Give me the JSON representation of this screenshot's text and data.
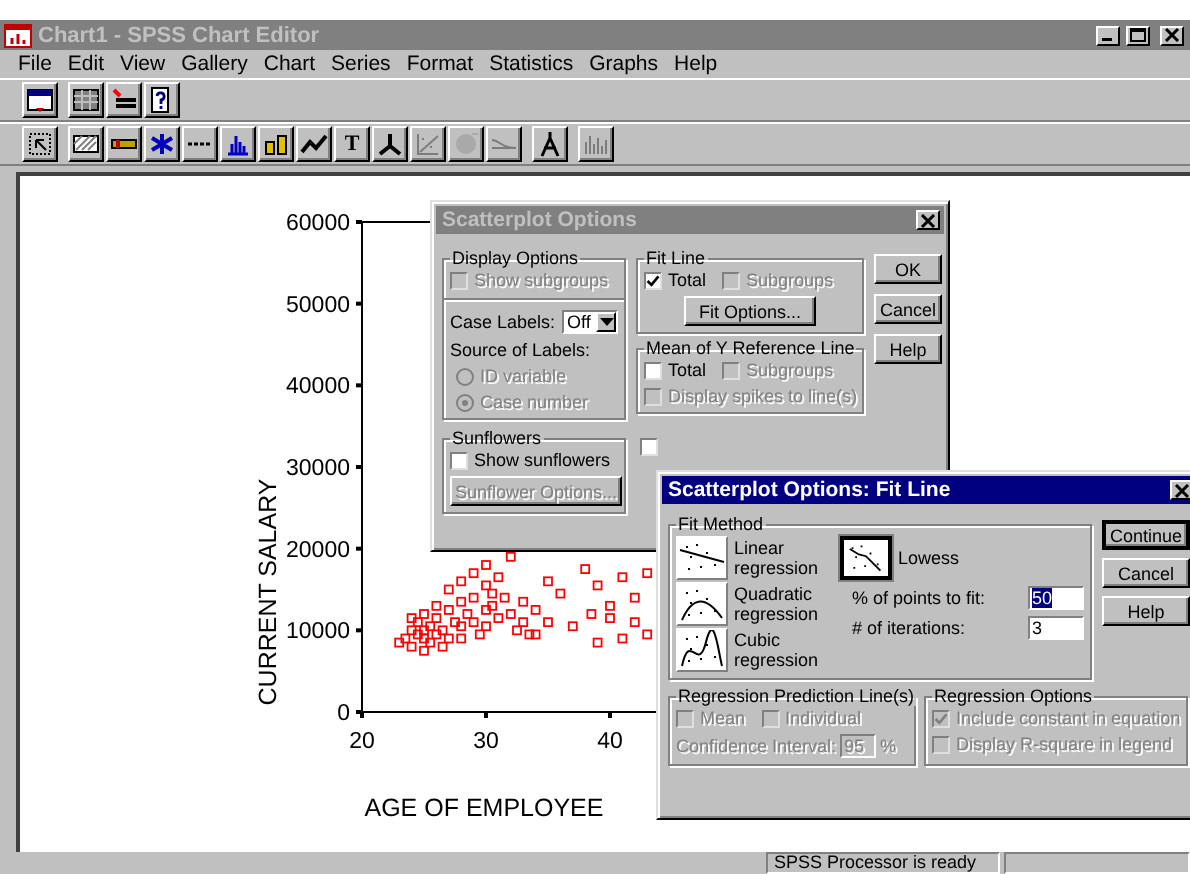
{
  "window": {
    "title": "Chart1 - SPSS Chart Editor"
  },
  "menu": [
    "File",
    "Edit",
    "View",
    "Gallery",
    "Chart",
    "Series",
    "Format",
    "Statistics",
    "Graphs",
    "Help"
  ],
  "toolbar_1": [
    [
      {
        "kind": "window",
        "disabled": false
      }
    ],
    [
      {
        "kind": "grid",
        "disabled": false
      },
      {
        "kind": "legend",
        "disabled": false
      },
      {
        "kind": "help",
        "disabled": false
      }
    ]
  ],
  "toolbar_2": [
    [
      {
        "kind": "selection",
        "disabled": false
      }
    ],
    [
      {
        "kind": "hatch",
        "disabled": false
      },
      {
        "kind": "paint",
        "disabled": false
      },
      {
        "kind": "asterisk",
        "disabled": false
      },
      {
        "kind": "dashed-line",
        "disabled": false
      },
      {
        "kind": "bar-chart",
        "disabled": false
      },
      {
        "kind": "labeled-bars",
        "disabled": false
      },
      {
        "kind": "line-chart",
        "disabled": false
      },
      {
        "kind": "text",
        "label": "T",
        "disabled": false
      },
      {
        "kind": "axes",
        "disabled": false
      },
      {
        "kind": "fit",
        "disabled": true
      },
      {
        "kind": "sphere",
        "disabled": true
      },
      {
        "kind": "smooth",
        "disabled": true
      }
    ],
    [
      {
        "kind": "compass",
        "disabled": false
      }
    ],
    [
      {
        "kind": "spikes",
        "disabled": true
      }
    ]
  ],
  "chart": {
    "chart_data": {
      "type": "scatter",
      "xlabel": "AGE OF EMPLOYEE",
      "ylabel": "CURRENT SALARY",
      "xticks": [
        20,
        30,
        40
      ],
      "xlim": [
        20,
        50
      ],
      "ylim": [
        0,
        60000
      ],
      "yticks": [
        0,
        10000,
        20000,
        30000,
        40000,
        50000,
        60000
      ],
      "x": [
        23,
        23.5,
        24,
        24,
        24.5,
        24.5,
        25,
        25,
        25,
        25.5,
        25.5,
        26,
        26,
        26,
        26.5,
        27,
        27,
        27,
        27.5,
        28,
        28,
        28,
        28.5,
        29,
        29,
        29,
        29.5,
        30,
        30,
        30,
        30,
        30.5,
        31,
        31,
        31.5,
        32,
        32,
        32.5,
        33,
        33,
        34,
        34,
        35,
        35,
        36,
        37,
        38,
        38.5,
        39,
        39,
        40,
        40,
        41,
        41,
        42,
        42,
        43,
        43,
        24,
        25,
        26.5,
        28,
        30.5,
        33.5
      ],
      "series": [
        {
          "color": "#ff0000",
          "values": [
            8500,
            9000,
            10000,
            8000,
            11000,
            9500,
            12000,
            9000,
            7500,
            10500,
            8500,
            11500,
            9500,
            13000,
            10000,
            12500,
            15000,
            9000,
            11000,
            13500,
            10500,
            16000,
            12000,
            14000,
            11000,
            17000,
            9500,
            12500,
            15500,
            18000,
            10500,
            13000,
            11500,
            16500,
            14000,
            12000,
            19000,
            10000,
            13500,
            11000,
            12500,
            9500,
            16000,
            11000,
            14500,
            10500,
            17500,
            12000,
            15500,
            8500,
            11500,
            13000,
            9000,
            16500,
            11000,
            14000,
            17000,
            9500,
            11500,
            10000,
            8000,
            9000,
            14500,
            9500
          ]
        }
      ]
    }
  },
  "scatterplot_options": {
    "title": "Scatterplot Options",
    "display_options": {
      "title": "Display Options",
      "show_subgroups": {
        "label": "Show subgroups",
        "checked": false,
        "disabled": true
      },
      "case_labels": {
        "label": "Case Labels:",
        "value": "Off"
      },
      "source_label": "Source of Labels:",
      "sources": [
        {
          "label": "ID variable",
          "selected": false,
          "disabled": true
        },
        {
          "label": "Case number",
          "selected": true,
          "disabled": true
        }
      ]
    },
    "sunflowers": {
      "title": "Sunflowers",
      "show": {
        "label": "Show sunflowers",
        "checked": false,
        "disabled": false
      },
      "button": {
        "label": "Sunflower Options...",
        "disabled": true
      }
    },
    "fit_line": {
      "title": "Fit Line",
      "options": [
        {
          "label": "Total",
          "checked": true,
          "disabled": false
        },
        {
          "label": "Subgroups",
          "checked": false,
          "disabled": true
        }
      ],
      "button": {
        "label": "Fit Options...",
        "disabled": false
      }
    },
    "mean_y": {
      "title": "Mean of Y Reference Line",
      "options": [
        {
          "label": "Total",
          "checked": false,
          "disabled": false
        },
        {
          "label": "Subgroups",
          "checked": false,
          "disabled": true
        }
      ],
      "spikes": {
        "label": "Display spikes to line(s)",
        "checked": false,
        "disabled": true
      }
    },
    "covered_checkbox": {
      "checked": false
    },
    "buttons": [
      "OK",
      "Cancel",
      "Help"
    ]
  },
  "fit_line_options": {
    "title": "Scatterplot Options: Fit Line",
    "fit_method": {
      "title": "Fit Method",
      "methods": [
        {
          "kind": "linear",
          "label": "Linear regression",
          "selected": false
        },
        {
          "kind": "quadratic",
          "label": "Quadratic regression",
          "selected": false
        },
        {
          "kind": "cubic",
          "label": "Cubic regression",
          "selected": false
        },
        {
          "kind": "lowess",
          "label": "Lowess",
          "selected": true
        }
      ],
      "points_label": "% of points to fit:",
      "points_value": "50",
      "points_value_selected": true,
      "iterations_label": "# of iterations:",
      "iterations_value": "3"
    },
    "prediction": {
      "title": "Regression Prediction Line(s)",
      "options": [
        {
          "label": "Mean",
          "checked": false,
          "disabled": true
        },
        {
          "label": "Individual",
          "checked": false,
          "disabled": true
        }
      ],
      "confidence_label": "Confidence Interval:",
      "confidence_value": "95",
      "unit": "%",
      "disabled": true
    },
    "regression_options": {
      "title": "Regression Options",
      "options": [
        {
          "label": "Include constant in equation",
          "checked": true,
          "disabled": true
        },
        {
          "label": "Display R-square in legend",
          "checked": false,
          "disabled": true
        }
      ]
    },
    "buttons": [
      "Continue",
      "Cancel",
      "Help"
    ]
  },
  "status_bar": {
    "message": "SPSS Processor is ready"
  }
}
